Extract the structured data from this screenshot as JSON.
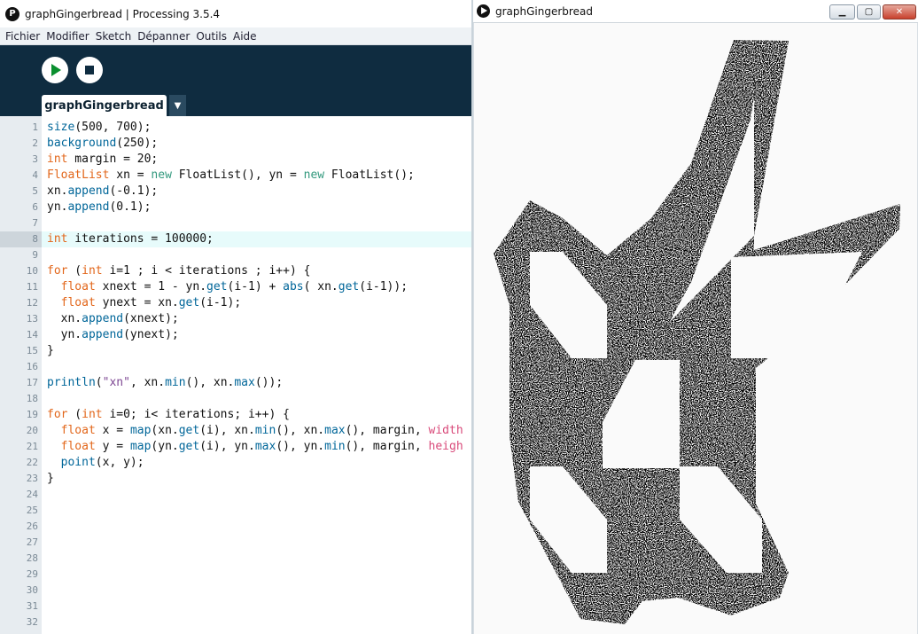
{
  "ide": {
    "title": "graphGingerbread | Processing 3.5.4",
    "logo_letter": "P",
    "menu": [
      "Fichier",
      "Modifier",
      "Sketch",
      "Dépanner",
      "Outils",
      "Aide"
    ],
    "tab_label": "graphGingerbread",
    "tab_menu_glyph": "▼",
    "active_line": 8,
    "line_count": 33
  },
  "sketch": {
    "title": "graphGingerbread",
    "min_glyph": "▁",
    "max_glyph": "▢",
    "close_glyph": "✕"
  },
  "colors": {
    "keyword": "#e2661a",
    "new_keyword": "#33997e",
    "function": "#006699",
    "string": "#7d4793",
    "builtin_var": "#d94a7a",
    "toolbar_bg": "#0f2c40",
    "run_green": "#0a8f2f"
  }
}
